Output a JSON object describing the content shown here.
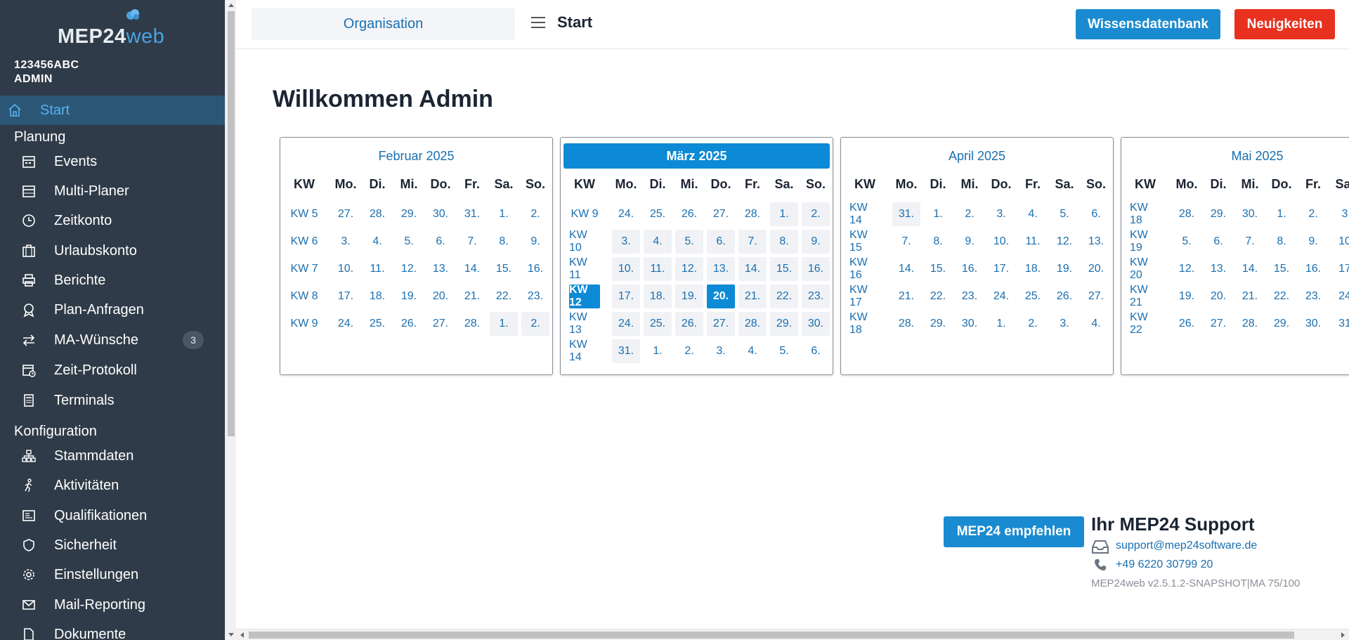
{
  "sidebar": {
    "logo_main": "MEP24",
    "logo_suffix": "web",
    "org_id": "123456ABC",
    "user_role": "ADMIN",
    "start_label": "Start",
    "sections": {
      "planung": "Planung",
      "konfiguration": "Konfiguration"
    },
    "items": {
      "events": "Events",
      "multiplaner": "Multi-Planer",
      "zeitkonto": "Zeitkonto",
      "urlaubskonto": "Urlaubskonto",
      "berichte": "Berichte",
      "plananfragen": "Plan-Anfragen",
      "mawuensche": "MA-Wünsche",
      "mawuensche_badge": "3",
      "zeitprotokoll": "Zeit-Protokoll",
      "terminals": "Terminals",
      "stammdaten": "Stammdaten",
      "aktivitaeten": "Aktivitäten",
      "qualifikationen": "Qualifikationen",
      "sicherheit": "Sicherheit",
      "einstellungen": "Einstellungen",
      "mailreporting": "Mail-Reporting",
      "dokumente": "Dokumente"
    }
  },
  "header": {
    "org_button": "Organisation",
    "title": "Start",
    "wissen_button": "Wissensdatenbank",
    "neu_button": "Neuigkeiten"
  },
  "main": {
    "welcome": "Willkommen Admin"
  },
  "calendar": {
    "dow": [
      "KW",
      "Mo.",
      "Di.",
      "Mi.",
      "Do.",
      "Fr.",
      "Sa.",
      "So."
    ],
    "months": [
      {
        "title": "Februar 2025",
        "highlighted": false,
        "rows": [
          [
            "KW 5",
            "27.",
            "28.",
            "29.",
            "30.",
            "31.",
            "1.",
            "2."
          ],
          [
            "KW 6",
            "3.",
            "4.",
            "5.",
            "6.",
            "7.",
            "8.",
            "9."
          ],
          [
            "KW 7",
            "10.",
            "11.",
            "12.",
            "13.",
            "14.",
            "15.",
            "16."
          ],
          [
            "KW 8",
            "17.",
            "18.",
            "19.",
            "20.",
            "21.",
            "22.",
            "23."
          ],
          [
            "KW 9",
            "24.",
            "25.",
            "26.",
            "27.",
            "28.",
            "1.",
            "2."
          ]
        ],
        "grey": [
          [
            4,
            6
          ],
          [
            4,
            7
          ]
        ]
      },
      {
        "title": "März 2025",
        "highlighted": true,
        "rows": [
          [
            "KW 9",
            "24.",
            "25.",
            "26.",
            "27.",
            "28.",
            "1.",
            "2."
          ],
          [
            "KW 10",
            "3.",
            "4.",
            "5.",
            "6.",
            "7.",
            "8.",
            "9."
          ],
          [
            "KW 11",
            "10.",
            "11.",
            "12.",
            "13.",
            "14.",
            "15.",
            "16."
          ],
          [
            "KW 12",
            "17.",
            "18.",
            "19.",
            "20.",
            "21.",
            "22.",
            "23."
          ],
          [
            "KW 13",
            "24.",
            "25.",
            "26.",
            "27.",
            "28.",
            "29.",
            "30."
          ],
          [
            "KW 14",
            "31.",
            "1.",
            "2.",
            "3.",
            "4.",
            "5.",
            "6."
          ]
        ],
        "grey": [
          [
            0,
            6
          ],
          [
            0,
            7
          ],
          [
            1,
            1
          ],
          [
            1,
            2
          ],
          [
            1,
            3
          ],
          [
            1,
            4
          ],
          [
            1,
            5
          ],
          [
            1,
            6
          ],
          [
            1,
            7
          ],
          [
            2,
            1
          ],
          [
            2,
            2
          ],
          [
            2,
            3
          ],
          [
            2,
            4
          ],
          [
            2,
            5
          ],
          [
            2,
            6
          ],
          [
            2,
            7
          ],
          [
            3,
            1
          ],
          [
            3,
            2
          ],
          [
            3,
            3
          ],
          [
            3,
            5
          ],
          [
            3,
            6
          ],
          [
            3,
            7
          ],
          [
            4,
            1
          ],
          [
            4,
            2
          ],
          [
            4,
            3
          ],
          [
            4,
            4
          ],
          [
            4,
            5
          ],
          [
            4,
            6
          ],
          [
            4,
            7
          ],
          [
            5,
            1
          ]
        ],
        "selected": [
          [
            3,
            0
          ],
          [
            3,
            4
          ]
        ]
      },
      {
        "title": "April 2025",
        "highlighted": false,
        "rows": [
          [
            "KW 14",
            "31.",
            "1.",
            "2.",
            "3.",
            "4.",
            "5.",
            "6."
          ],
          [
            "KW 15",
            "7.",
            "8.",
            "9.",
            "10.",
            "11.",
            "12.",
            "13."
          ],
          [
            "KW 16",
            "14.",
            "15.",
            "16.",
            "17.",
            "18.",
            "19.",
            "20."
          ],
          [
            "KW 17",
            "21.",
            "22.",
            "23.",
            "24.",
            "25.",
            "26.",
            "27."
          ],
          [
            "KW 18",
            "28.",
            "29.",
            "30.",
            "1.",
            "2.",
            "3.",
            "4."
          ]
        ],
        "grey": [
          [
            0,
            1
          ]
        ]
      },
      {
        "title": "Mai 2025",
        "highlighted": false,
        "rows": [
          [
            "KW 18",
            "28.",
            "29.",
            "30.",
            "1.",
            "2.",
            "3"
          ],
          [
            "KW 19",
            "5.",
            "6.",
            "7.",
            "8.",
            "9.",
            "10"
          ],
          [
            "KW 20",
            "12.",
            "13.",
            "14.",
            "15.",
            "16.",
            "17"
          ],
          [
            "KW 21",
            "19.",
            "20.",
            "21.",
            "22.",
            "23.",
            "24"
          ],
          [
            "KW 22",
            "26.",
            "27.",
            "28.",
            "29.",
            "30.",
            "31"
          ]
        ],
        "grey": []
      }
    ]
  },
  "support": {
    "empfehlen_button": "MEP24 empfehlen",
    "title": "Ihr MEP24 Support",
    "email": "support@mep24software.de",
    "phone": "+49 6220 30799 20",
    "version": "MEP24web v2.5.1.2-SNAPSHOT|MA 75/100"
  },
  "colors": {
    "sidebar_bg": "#2f3b48",
    "accent": "#1a8bd0",
    "danger": "#e8311e",
    "link": "#1a6fb0"
  }
}
